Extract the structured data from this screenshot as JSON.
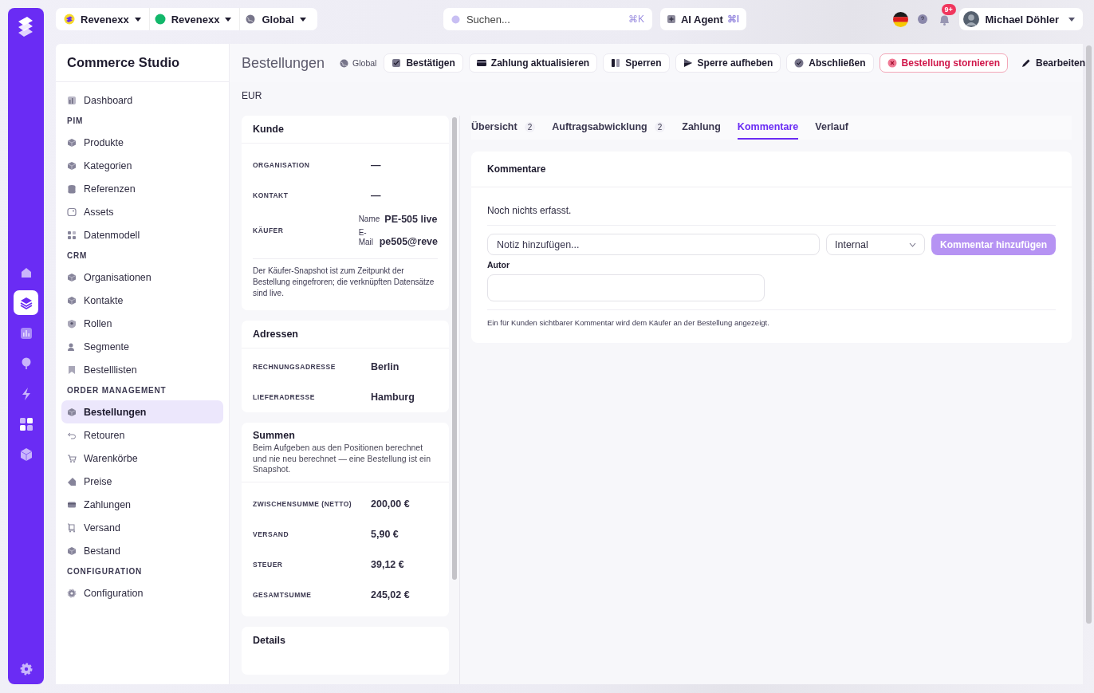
{
  "switchers": [
    {
      "label": "Revenexx"
    },
    {
      "label": "Revenexx"
    },
    {
      "label": "Global"
    }
  ],
  "search": {
    "placeholder": "Suchen...",
    "shortcut": "⌘K"
  },
  "ai_agent": {
    "label": "AI Agent",
    "shortcut": "⌘I"
  },
  "notifications": {
    "badge": "9+"
  },
  "user": {
    "name": "Michael Döhler"
  },
  "rail": {
    "items": [
      {
        "selected": false
      },
      {
        "selected": true
      },
      {
        "selected": false
      },
      {
        "selected": false
      },
      {
        "selected": false
      },
      {
        "selected": false
      },
      {
        "selected": false
      }
    ]
  },
  "sidebar": {
    "title": "Commerce Studio",
    "sections": [
      {
        "items": [
          {
            "label": "Dashboard",
            "selected": false
          }
        ]
      },
      {
        "heading": "PIM",
        "items": [
          {
            "label": "Produkte",
            "selected": false
          },
          {
            "label": "Kategorien",
            "selected": false
          },
          {
            "label": "Referenzen",
            "selected": false
          },
          {
            "label": "Assets",
            "selected": false
          },
          {
            "label": "Datenmodell",
            "selected": false
          }
        ]
      },
      {
        "heading": "CRM",
        "items": [
          {
            "label": "Organisationen",
            "selected": false
          },
          {
            "label": "Kontakte",
            "selected": false
          },
          {
            "label": "Rollen",
            "selected": false
          },
          {
            "label": "Segmente",
            "selected": false
          },
          {
            "label": "Bestelllisten",
            "selected": false
          }
        ]
      },
      {
        "heading": "ORDER MANAGEMENT",
        "items": [
          {
            "label": "Bestellungen",
            "selected": true
          },
          {
            "label": "Retouren",
            "selected": false
          },
          {
            "label": "Warenkörbe",
            "selected": false
          },
          {
            "label": "Preise",
            "selected": false
          },
          {
            "label": "Zahlungen",
            "selected": false
          },
          {
            "label": "Versand",
            "selected": false
          },
          {
            "label": "Bestand",
            "selected": false
          }
        ]
      },
      {
        "heading": "CONFIGURATION",
        "items": [
          {
            "label": "Configuration",
            "selected": false
          }
        ]
      }
    ]
  },
  "page": {
    "title": "Bestellungen",
    "scope": "Global",
    "currency": "EUR",
    "actions": [
      {
        "label": "Bestätigen",
        "kind": "default"
      },
      {
        "label": "Zahlung aktualisieren",
        "kind": "default"
      },
      {
        "label": "Sperren",
        "kind": "default"
      },
      {
        "label": "Sperre aufheben",
        "kind": "default"
      },
      {
        "label": "Abschließen",
        "kind": "default"
      },
      {
        "label": "Bestellung stornieren",
        "kind": "danger"
      },
      {
        "label": "Bearbeiten",
        "kind": "plain"
      }
    ]
  },
  "customer": {
    "title": "Kunde",
    "fields": [
      {
        "label": "ORGANISATION",
        "value": "—"
      },
      {
        "label": "KONTAKT",
        "value": "—"
      }
    ],
    "buyer": {
      "label": "KÄUFER",
      "name_label": "Name",
      "name": "PE-505 live",
      "email_label": "E-Mail",
      "email": "pe505@reve"
    },
    "note": "Der Käufer-Snapshot ist zum Zeitpunkt der Bestellung eingefroren; die verknüpften Datensätze sind live."
  },
  "addresses": {
    "title": "Adressen",
    "fields": [
      {
        "label": "RECHNUNGSADRESSE",
        "value": "Berlin"
      },
      {
        "label": "LIEFERADRESSE",
        "value": "Hamburg"
      }
    ]
  },
  "totals": {
    "title": "Summen",
    "description": "Beim Aufgeben aus den Positionen berechnet und nie neu berechnet — eine Bestellung ist ein Snapshot.",
    "fields": [
      {
        "label": "ZWISCHENSUMME (NETTO)",
        "value": "200,00 €"
      },
      {
        "label": "VERSAND",
        "value": "5,90 €"
      },
      {
        "label": "STEUER",
        "value": "39,12 €"
      },
      {
        "label": "GESAMTSUMME",
        "value": "245,02 €"
      }
    ]
  },
  "details": {
    "title": "Details"
  },
  "tabs": [
    {
      "label": "Übersicht",
      "count": "2",
      "selected": false
    },
    {
      "label": "Auftragsabwicklung",
      "count": "2",
      "selected": false
    },
    {
      "label": "Zahlung",
      "selected": false
    },
    {
      "label": "Kommentare",
      "selected": true
    },
    {
      "label": "Verlauf",
      "selected": false
    }
  ],
  "comments": {
    "title": "Kommentare",
    "empty": "Noch nichts erfasst.",
    "note_placeholder": "Notiz hinzufügen...",
    "visibility": "Internal",
    "submit": {
      "label": "Kommentar hinzufügen",
      "disabled": true
    },
    "author_label": "Autor",
    "hint": "Ein für Kunden sichtbarer Kommentar wird dem Käufer an der Bestellung angezeigt."
  }
}
